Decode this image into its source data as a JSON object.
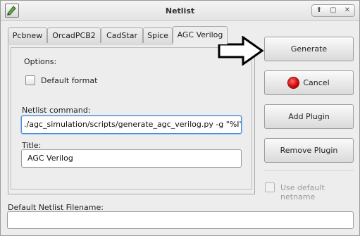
{
  "window": {
    "title": "Netlist",
    "controls": {
      "minimize": "⬆",
      "maximize": "▢",
      "close": "✕"
    }
  },
  "tabs": [
    {
      "label": "Pcbnew"
    },
    {
      "label": "OrcadPCB2"
    },
    {
      "label": "CadStar"
    },
    {
      "label": "Spice"
    },
    {
      "label": "AGC Verilog",
      "active": true
    }
  ],
  "panel": {
    "options_label": "Options:",
    "default_format_label": "Default format",
    "default_format_checked": false,
    "netlist_command_label": "Netlist command:",
    "netlist_command_value": "./agc_simulation/scripts/generate_agc_verilog.py -g \"%I\" \"%O\"",
    "title_label": "Title:",
    "title_value": "AGC Verilog"
  },
  "buttons": {
    "generate": "Generate",
    "cancel": "Cancel",
    "add_plugin": "Add Plugin",
    "remove_plugin": "Remove Plugin"
  },
  "use_default_netname": {
    "label": "Use default netname",
    "checked": false,
    "enabled": false
  },
  "default_netlist_filename": {
    "label": "Default Netlist Filename:",
    "value": ""
  },
  "colors": {
    "accent_focus": "#4a8fd8",
    "cancel_icon": "#d10000"
  },
  "icons": {
    "app": "schematic-app-icon",
    "cancel": "stop-icon",
    "annotation": "right-arrow-icon"
  }
}
